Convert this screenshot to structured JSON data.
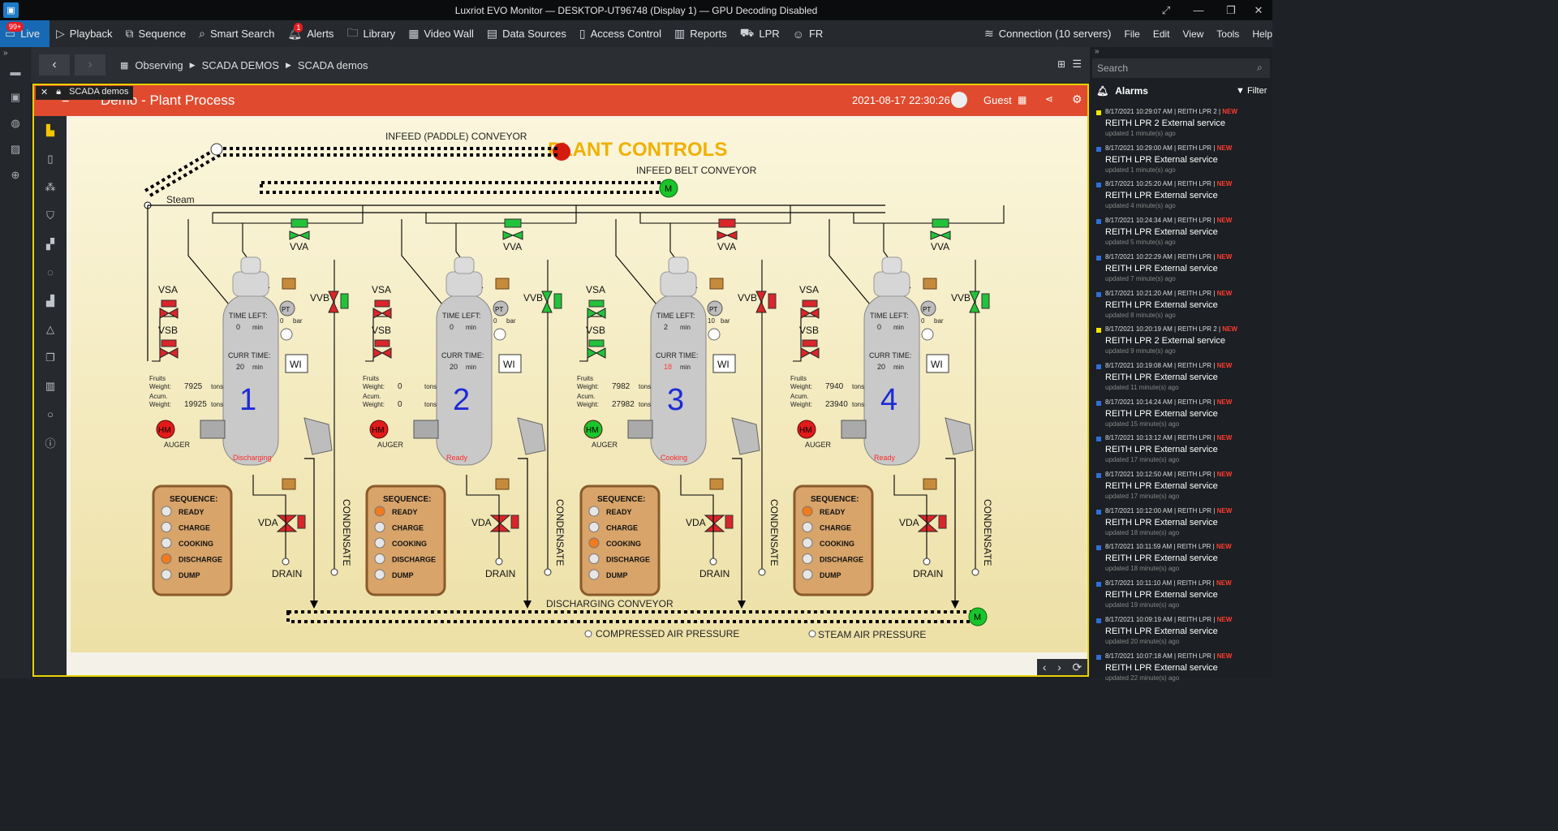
{
  "window": {
    "title": "Luxriot EVO Monitor — DESKTOP-UT96748 (Display 1) — GPU Decoding Disabled"
  },
  "menu": {
    "live": "Live",
    "live_badge": "99+",
    "playback": "Playback",
    "sequence": "Sequence",
    "smart_search": "Smart Search",
    "alerts": "Alerts",
    "alerts_badge": "1",
    "library": "Library",
    "video_wall": "Video Wall",
    "data_sources": "Data Sources",
    "access_control": "Access Control",
    "reports": "Reports",
    "lpr": "LPR",
    "fr": "FR",
    "connection": "Connection (10 servers)",
    "file": "File",
    "edit": "Edit",
    "view": "View",
    "tools": "Tools",
    "help": "Help"
  },
  "breadcrumb": [
    "Observing",
    "SCADA DEMOS",
    "SCADA demos"
  ],
  "viewer": {
    "tab_label": "SCADA demos",
    "title": "Demo - Plant Process",
    "date": "2021-08-17 22:30:26",
    "user": "Guest"
  },
  "scada": {
    "title": "PLANT CONTROLS",
    "infeed_paddle": "INFEED (PADDLE) CONVEYOR",
    "infeed_belt": "INFEED BELT CONVEYOR",
    "steam": "Steam",
    "discharging": "DISCHARGING CONVEYOR",
    "compressed_air": "COMPRESSED AIR PRESSURE",
    "steam_air": "STEAM AIR PRESSURE",
    "labels": {
      "vva": "VVA",
      "vvb": "VVB",
      "vsa": "VSA",
      "vsb": "VSB",
      "vda": "VDA",
      "drain": "DRAIN",
      "condensate": "CONDENSATE",
      "auger": "AUGER",
      "hm": "HM",
      "m": "M",
      "wi": "WI",
      "pt": "PT",
      "bar": "bar",
      "min": "min",
      "tons": "tons",
      "time_left": "TIME LEFT:",
      "curr_time": "CURR TIME:",
      "fruits_weight_1": "Fruits",
      "fruits_weight_2": "Weight:",
      "acum_weight_1": "Acum.",
      "acum_weight_2": "Weight:",
      "sequence": "SEQUENCE:"
    },
    "sequence_steps": [
      "READY",
      "CHARGE",
      "COOKING",
      "DISCHARGE",
      "DUMP"
    ],
    "units": [
      {
        "num": "1",
        "time_left": "0",
        "curr_time": "20",
        "pressure": "0",
        "fruits": "7925",
        "acum": "19925",
        "status": "Discharging",
        "active_step": 3,
        "auger_on": false
      },
      {
        "num": "2",
        "time_left": "0",
        "curr_time": "20",
        "pressure": "0",
        "fruits": "0",
        "acum": "0",
        "status": "Ready",
        "active_step": 0,
        "auger_on": false
      },
      {
        "num": "3",
        "time_left": "2",
        "curr_time": "18",
        "pressure": "10",
        "fruits": "7982",
        "acum": "27982",
        "status": "Cooking",
        "active_step": 2,
        "auger_on": true
      },
      {
        "num": "4",
        "time_left": "0",
        "curr_time": "20",
        "pressure": "0",
        "fruits": "7940",
        "acum": "23940",
        "status": "Ready",
        "active_step": 0,
        "auger_on": false
      }
    ]
  },
  "right_panel": {
    "search_placeholder": "Search",
    "alarms_title": "Alarms",
    "filter": "Filter",
    "alarms": [
      {
        "time": "8/17/2021 10:29:07 AM",
        "src": "REITH LPR 2",
        "new": "NEW",
        "text": "REITH LPR 2 External service",
        "ago": "updated 1 minute(s) ago",
        "color": "#f2e600"
      },
      {
        "time": "8/17/2021 10:29:00 AM",
        "src": "REITH LPR",
        "new": "NEW",
        "text": "REITH LPR External service",
        "ago": "updated 1 minute(s) ago",
        "color": "#2f6fd6"
      },
      {
        "time": "8/17/2021 10:25:20 AM",
        "src": "REITH LPR",
        "new": "NEW",
        "text": "REITH LPR External service",
        "ago": "updated 4 minute(s) ago",
        "color": "#2f6fd6"
      },
      {
        "time": "8/17/2021 10:24:34 AM",
        "src": "REITH LPR",
        "new": "NEW",
        "text": "REITH LPR External service",
        "ago": "updated 5 minute(s) ago",
        "color": "#2f6fd6"
      },
      {
        "time": "8/17/2021 10:22:29 AM",
        "src": "REITH LPR",
        "new": "NEW",
        "text": "REITH LPR External service",
        "ago": "updated 7 minute(s) ago",
        "color": "#2f6fd6"
      },
      {
        "time": "8/17/2021 10:21:20 AM",
        "src": "REITH LPR",
        "new": "NEW",
        "text": "REITH LPR External service",
        "ago": "updated 8 minute(s) ago",
        "color": "#2f6fd6"
      },
      {
        "time": "8/17/2021 10:20:19 AM",
        "src": "REITH LPR 2",
        "new": "NEW",
        "text": "REITH LPR 2 External service",
        "ago": "updated 9 minute(s) ago",
        "color": "#f2e600"
      },
      {
        "time": "8/17/2021 10:19:08 AM",
        "src": "REITH LPR",
        "new": "NEW",
        "text": "REITH LPR External service",
        "ago": "updated 11 minute(s) ago",
        "color": "#2f6fd6"
      },
      {
        "time": "8/17/2021 10:14:24 AM",
        "src": "REITH LPR",
        "new": "NEW",
        "text": "REITH LPR External service",
        "ago": "updated 15 minute(s) ago",
        "color": "#2f6fd6"
      },
      {
        "time": "8/17/2021 10:13:12 AM",
        "src": "REITH LPR",
        "new": "NEW",
        "text": "REITH LPR External service",
        "ago": "updated 17 minute(s) ago",
        "color": "#2f6fd6"
      },
      {
        "time": "8/17/2021 10:12:50 AM",
        "src": "REITH LPR",
        "new": "NEW",
        "text": "REITH LPR External service",
        "ago": "updated 17 minute(s) ago",
        "color": "#2f6fd6"
      },
      {
        "time": "8/17/2021 10:12:00 AM",
        "src": "REITH LPR",
        "new": "NEW",
        "text": "REITH LPR External service",
        "ago": "updated 18 minute(s) ago",
        "color": "#2f6fd6"
      },
      {
        "time": "8/17/2021 10:11:59 AM",
        "src": "REITH LPR",
        "new": "NEW",
        "text": "REITH LPR External service",
        "ago": "updated 18 minute(s) ago",
        "color": "#2f6fd6"
      },
      {
        "time": "8/17/2021 10:11:10 AM",
        "src": "REITH LPR",
        "new": "NEW",
        "text": "REITH LPR External service",
        "ago": "updated 19 minute(s) ago",
        "color": "#2f6fd6"
      },
      {
        "time": "8/17/2021 10:09:19 AM",
        "src": "REITH LPR",
        "new": "NEW",
        "text": "REITH LPR External service",
        "ago": "updated 20 minute(s) ago",
        "color": "#2f6fd6"
      },
      {
        "time": "8/17/2021 10:07:18 AM",
        "src": "REITH LPR",
        "new": "NEW",
        "text": "REITH LPR External service",
        "ago": "updated 22 minute(s) ago",
        "color": "#2f6fd6"
      }
    ]
  }
}
